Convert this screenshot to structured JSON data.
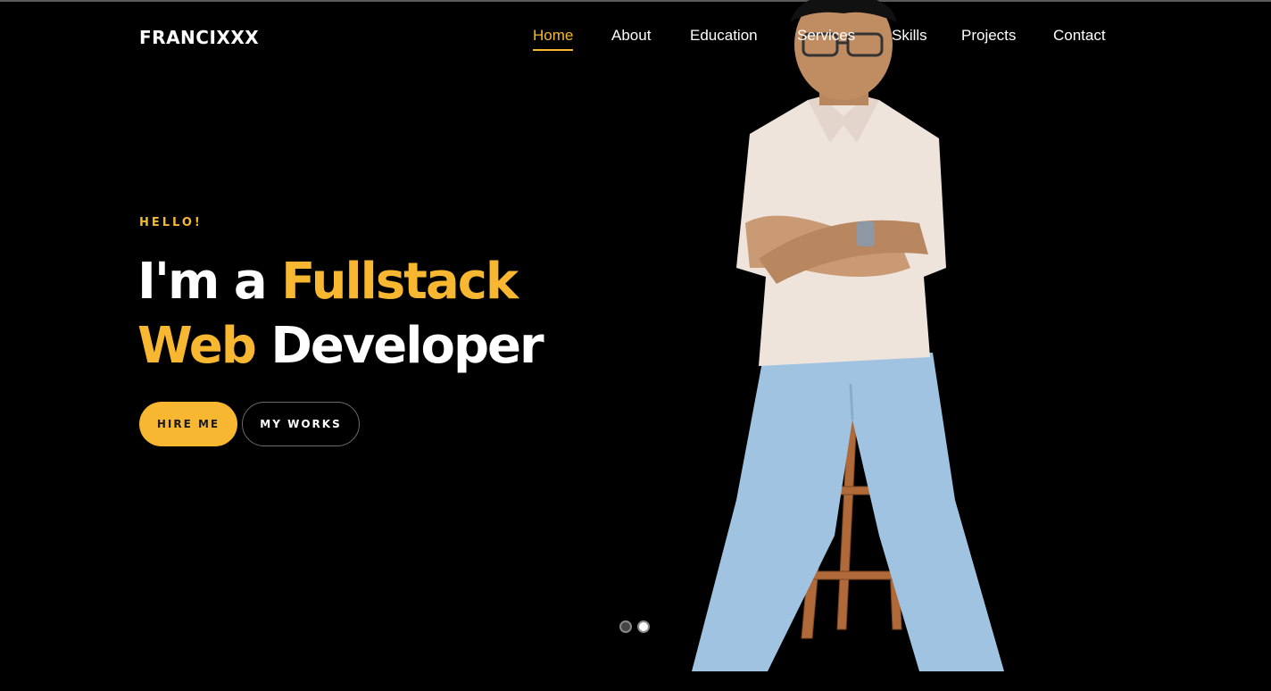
{
  "brand": {
    "logo_text": "FRANCIXXX"
  },
  "nav": {
    "items": [
      {
        "label": "Home",
        "active": true
      },
      {
        "label": "About"
      },
      {
        "label": "Education"
      },
      {
        "label": "Services"
      },
      {
        "label": "Skills"
      },
      {
        "label": "Projects"
      },
      {
        "label": "Contact"
      }
    ]
  },
  "hero": {
    "greeting": "HELLO!",
    "headline": {
      "part1": "I'm a ",
      "part2": "Fullstack",
      "part3": "Web",
      "part4": " Developer"
    },
    "buttons": {
      "primary": "HIRE ME",
      "secondary": "MY WORKS"
    }
  },
  "slider": {
    "total_slides": 2,
    "active_slide": 2
  },
  "colors": {
    "background": "#000000",
    "accent": "#f8b730",
    "text": "#ffffff",
    "shirt": "#efe4dc",
    "jeans": "#9fc3e1",
    "stool": "#b06a3a"
  },
  "icons": [
    "slider-dot"
  ]
}
